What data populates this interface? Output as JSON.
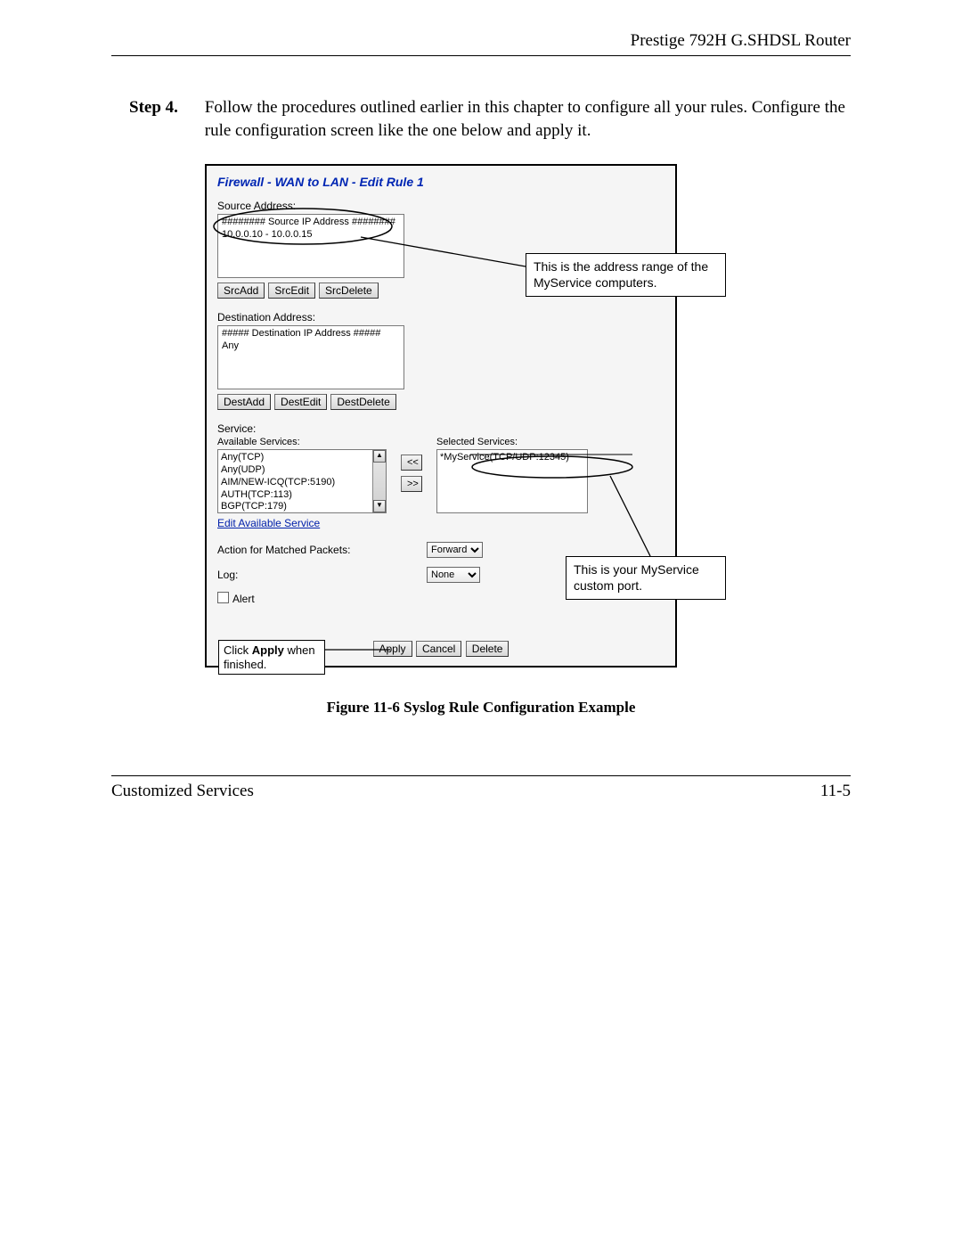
{
  "header": {
    "title": "Prestige 792H G.SHDSL Router"
  },
  "step": {
    "label": "Step 4.",
    "text": "Follow the procedures outlined earlier in this chapter to configure all your rules. Configure the rule configuration screen like the one below and apply it."
  },
  "panel": {
    "title": "Firewall - WAN to LAN - Edit Rule 1",
    "source": {
      "label": "Source Address:",
      "list_header": "######## Source IP Address ########",
      "list_item": "10.0.0.10 - 10.0.0.15",
      "buttons": {
        "add": "SrcAdd",
        "edit": "SrcEdit",
        "del": "SrcDelete"
      }
    },
    "dest": {
      "label": "Destination Address:",
      "list_header": "##### Destination IP Address #####",
      "list_item": "Any",
      "buttons": {
        "add": "DestAdd",
        "edit": "DestEdit",
        "del": "DestDelete"
      }
    },
    "service": {
      "label": "Service:",
      "available_label": "Available Services:",
      "selected_label": "Selected Services:",
      "available": [
        "Any(TCP)",
        "Any(UDP)",
        "AIM/NEW-ICQ(TCP:5190)",
        "AUTH(TCP:113)",
        "BGP(TCP:179)"
      ],
      "selected": "*MyService(TCP/UDP:12345)",
      "edit_link": "Edit Available Service",
      "move_left": "<<",
      "move_right": ">>"
    },
    "action": {
      "label": "Action for Matched Packets:",
      "value": "Forward",
      "log_label": "Log:",
      "log_value": "None",
      "alert_label": "Alert"
    },
    "bottom_buttons": {
      "apply": "Apply",
      "cancel": "Cancel",
      "del": "Delete"
    }
  },
  "callouts": {
    "address_range": "This is the address range of the MyService computers.",
    "custom_port": "This is your MyService custom port.",
    "apply_hint_a": "Click ",
    "apply_hint_b": "Apply",
    "apply_hint_c": " when finished."
  },
  "figure_caption": "Figure 11-6 Syslog Rule Configuration Example",
  "footer": {
    "left": "Customized Services",
    "right": "11-5"
  }
}
